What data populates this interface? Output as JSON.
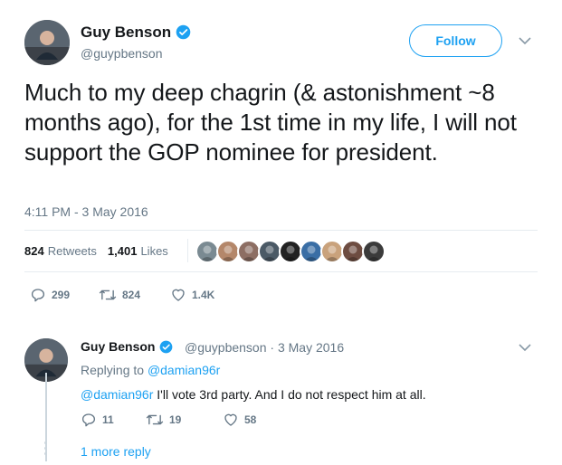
{
  "tweet": {
    "author_name": "Guy Benson",
    "author_handle": "@guypbenson",
    "follow_label": "Follow",
    "text": "Much to my deep chagrin (& astonishment ~8 months ago), for the 1st time in my life, I will not support the GOP nominee for president.",
    "timestamp": "4:11 PM - 3 May 2016",
    "retweets_count": "824",
    "retweets_label": "Retweets",
    "likes_count": "1,401",
    "likes_label": "Likes",
    "actions": {
      "replies": "299",
      "retweets": "824",
      "likes": "1.4K"
    },
    "likers": [
      {
        "icon": "avatar-1",
        "color": "#7a8a92"
      },
      {
        "icon": "avatar-2",
        "color": "#b4876a"
      },
      {
        "icon": "avatar-3",
        "color": "#8d6e63"
      },
      {
        "icon": "avatar-4",
        "color": "#4b5a66"
      },
      {
        "icon": "avatar-5",
        "color": "#222222"
      },
      {
        "icon": "avatar-tpp",
        "color": "#3a6ea5"
      },
      {
        "icon": "avatar-7",
        "color": "#c9a27c"
      },
      {
        "icon": "avatar-8",
        "color": "#6d4c41"
      },
      {
        "icon": "avatar-9",
        "color": "#3b3b3b"
      }
    ]
  },
  "reply": {
    "author_name": "Guy Benson",
    "author_handle": "@guypbenson",
    "separator": " · ",
    "date": "3 May 2016",
    "replying_prefix": "Replying to",
    "replying_to": "@damian96r",
    "mention": "@damian96r",
    "text": " I'll vote 3rd party. And I do not respect him at all.",
    "actions": {
      "replies": "11",
      "retweets": "19",
      "likes": "58"
    },
    "more_replies_label": "1 more reply"
  },
  "colors": {
    "accent": "#1da1f2",
    "secondary_text": "#657786",
    "primary_text": "#14171a",
    "divider": "#e6ecf0"
  }
}
